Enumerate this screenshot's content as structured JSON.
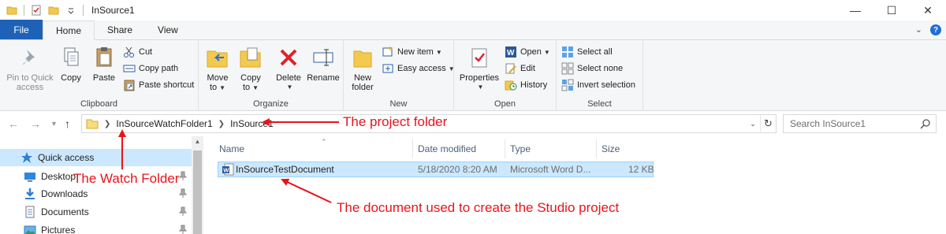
{
  "window": {
    "title": "InSource1",
    "controls": {
      "minimize": "—",
      "maximize": "☐",
      "close": "✕"
    }
  },
  "ribbon_tabs": [
    "File",
    "Home",
    "Share",
    "View"
  ],
  "ribbon": {
    "clipboard": {
      "label": "Clipboard",
      "pin_line1": "Pin to Quick",
      "pin_line2": "access",
      "copy": "Copy",
      "paste": "Paste",
      "cut": "Cut",
      "copy_path": "Copy path",
      "paste_shortcut": "Paste shortcut"
    },
    "organize": {
      "label": "Organize",
      "move_line1": "Move",
      "move_line2": "to",
      "copy_line1": "Copy",
      "copy_line2": "to",
      "delete": "Delete",
      "rename": "Rename"
    },
    "new": {
      "label": "New",
      "folder_line1": "New",
      "folder_line2": "folder",
      "new_item": "New item",
      "easy_access": "Easy access"
    },
    "open": {
      "label": "Open",
      "properties": "Properties",
      "open": "Open",
      "edit": "Edit",
      "history": "History"
    },
    "select": {
      "label": "Select",
      "select_all": "Select all",
      "select_none": "Select none",
      "invert": "Invert selection"
    }
  },
  "address": {
    "crumbs": [
      "InSourceWatchFolder1",
      "InSource1"
    ],
    "search_placeholder": "Search InSource1"
  },
  "nav_pane": {
    "items": [
      {
        "label": "Quick access",
        "selected": true
      },
      {
        "label": "Desktop"
      },
      {
        "label": "Downloads"
      },
      {
        "label": "Documents"
      },
      {
        "label": "Pictures"
      }
    ]
  },
  "file_list": {
    "columns": [
      "Name",
      "Date modified",
      "Type",
      "Size"
    ],
    "rows": [
      {
        "name": "InSourceTestDocument",
        "date": "5/18/2020 8:20 AM",
        "type": "Microsoft Word D...",
        "size": "12 KB"
      }
    ]
  },
  "annotations": {
    "project_folder": "The project folder",
    "watch_folder": "The Watch Folder",
    "document": "The document used to create the Studio project"
  },
  "colors": {
    "accent": "#1e62b8",
    "selection": "#cce8ff",
    "annotation": "#e8141a"
  }
}
